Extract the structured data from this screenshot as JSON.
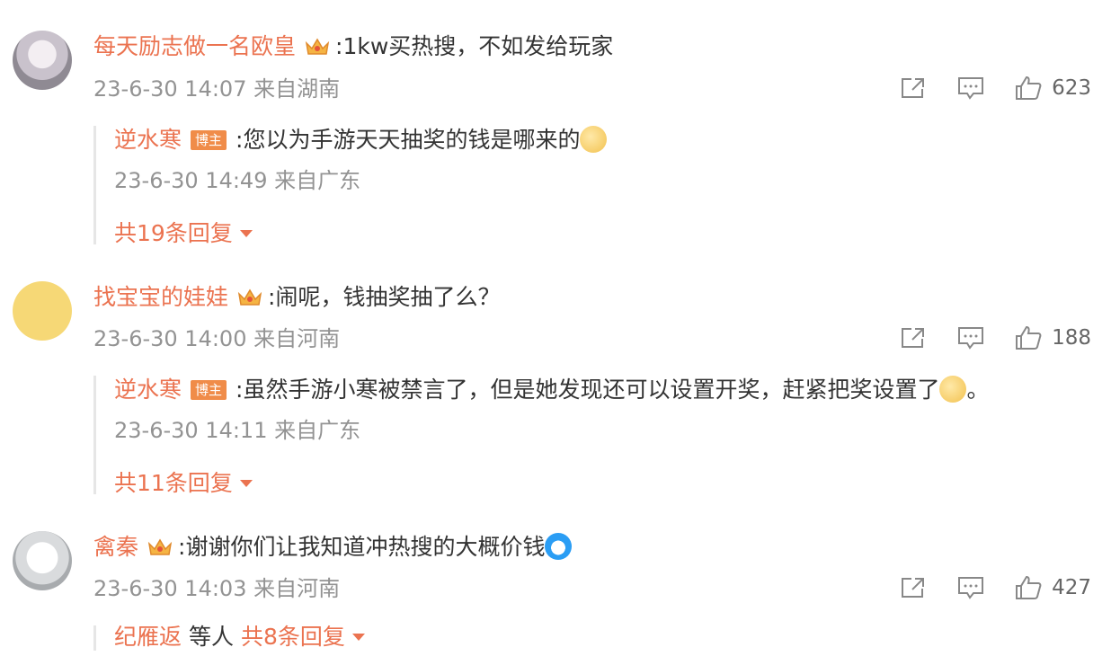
{
  "comments": [
    {
      "username": "每天励志做一名欧皇",
      "text": ":1kw买热搜，不如发给玩家",
      "meta": "23-6-30 14:07 来自湖南",
      "likes": "623",
      "reply": {
        "username": "逆水寒",
        "badge": "博主",
        "text": ":您以为手游天天抽奖的钱是哪来的",
        "meta": "23-6-30 14:49 来自广东",
        "more": "共19条回复"
      }
    },
    {
      "username": "找宝宝的娃娃",
      "text": ":闹呢，钱抽奖抽了么？",
      "meta": "23-6-30 14:00 来自河南",
      "likes": "188",
      "reply": {
        "username": "逆水寒",
        "badge": "博主",
        "text": ":虽然手游小寒被禁言了，但是她发现还可以设置开奖，赶紧把奖设置了",
        "text_end": "。",
        "meta": "23-6-30 14:11 来自广东",
        "more": "共11条回复"
      }
    },
    {
      "username": "禽秦",
      "text": ":谢谢你们让我知道冲热搜的大概价钱",
      "meta": "23-6-30 14:03 来自河南",
      "likes": "427",
      "reply_summary": {
        "username": "纪雁返",
        "others": "等人",
        "more": "共8条回复"
      }
    }
  ],
  "icons": {
    "share": "share-icon",
    "comment": "comment-icon",
    "like": "like-icon",
    "crown": "crown-badge-icon",
    "dropdown": "chevron-down-icon"
  },
  "colors": {
    "username": "#eb7350",
    "meta": "#939393",
    "badge": "#f08c49",
    "text": "#333333"
  }
}
